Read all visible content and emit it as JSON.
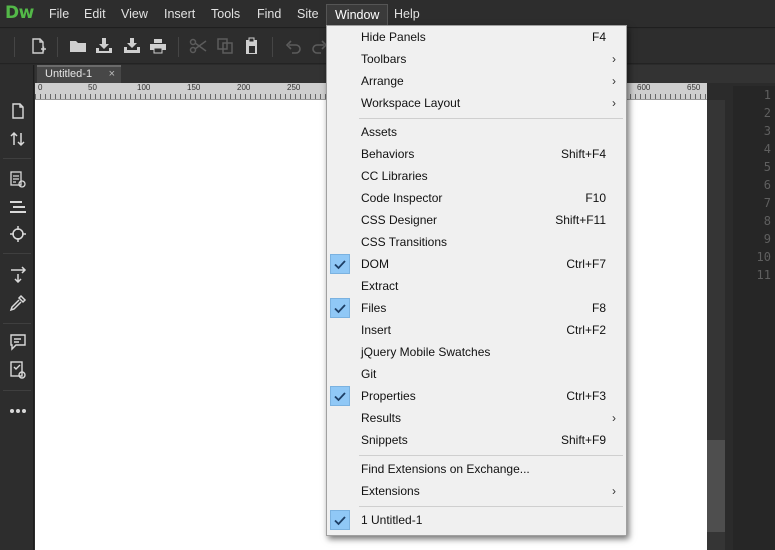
{
  "app": {
    "logo": "Dw"
  },
  "menubar": {
    "items": [
      {
        "label": "File"
      },
      {
        "label": "Edit"
      },
      {
        "label": "View"
      },
      {
        "label": "Insert"
      },
      {
        "label": "Tools"
      },
      {
        "label": "Find"
      },
      {
        "label": "Site"
      },
      {
        "label": "Window",
        "active": true
      },
      {
        "label": "Help"
      }
    ]
  },
  "toolbar": {
    "buttons": [
      {
        "icon": "new-file-icon"
      },
      {
        "icon": "open-folder-icon"
      },
      {
        "icon": "save-icon"
      },
      {
        "icon": "save-all-icon"
      },
      {
        "icon": "print-icon"
      },
      {
        "icon": "cut-icon",
        "enabled": false
      },
      {
        "icon": "copy-icon",
        "enabled": false
      },
      {
        "icon": "paste-icon"
      },
      {
        "icon": "undo-icon",
        "enabled": false
      },
      {
        "icon": "redo-icon",
        "enabled": false
      }
    ]
  },
  "left_panel": {
    "buttons": [
      {
        "icon": "file-icon"
      },
      {
        "icon": "sort-icon"
      },
      {
        "icon": "live-view-icon"
      },
      {
        "icon": "text-align-icon"
      },
      {
        "icon": "target-icon"
      },
      {
        "icon": "expand-icon"
      },
      {
        "icon": "eyedropper-icon"
      },
      {
        "icon": "comment-icon"
      },
      {
        "icon": "validate-icon"
      },
      {
        "icon": "more-icon"
      }
    ]
  },
  "document": {
    "tab_title": "Untitled-1",
    "tab_close": "×",
    "ruler_labels": [
      "0",
      "50",
      "100",
      "150",
      "200",
      "250",
      "600",
      "650"
    ],
    "line_numbers": [
      "1",
      "2",
      "3",
      "4",
      "5",
      "6",
      "7",
      "8",
      "9",
      "10",
      "11"
    ]
  },
  "window_menu": {
    "items": [
      {
        "label": "Hide Panels",
        "shortcut": "F4",
        "submenu": false,
        "checked": false
      },
      {
        "label": "Toolbars",
        "shortcut": "",
        "submenu": true,
        "checked": false
      },
      {
        "label": "Arrange",
        "shortcut": "",
        "submenu": true,
        "checked": false
      },
      {
        "label": "Workspace Layout",
        "shortcut": "",
        "submenu": true,
        "checked": false
      },
      {
        "separator": true
      },
      {
        "label": "Assets",
        "shortcut": "",
        "submenu": false,
        "checked": false
      },
      {
        "label": "Behaviors",
        "shortcut": "Shift+F4",
        "submenu": false,
        "checked": false
      },
      {
        "label": "CC Libraries",
        "shortcut": "",
        "submenu": false,
        "checked": false
      },
      {
        "label": "Code Inspector",
        "shortcut": "F10",
        "submenu": false,
        "checked": false
      },
      {
        "label": "CSS Designer",
        "shortcut": "Shift+F11",
        "submenu": false,
        "checked": false
      },
      {
        "label": "CSS Transitions",
        "shortcut": "",
        "submenu": false,
        "checked": false
      },
      {
        "label": "DOM",
        "shortcut": "Ctrl+F7",
        "submenu": false,
        "checked": true
      },
      {
        "label": "Extract",
        "shortcut": "",
        "submenu": false,
        "checked": false
      },
      {
        "label": "Files",
        "shortcut": "F8",
        "submenu": false,
        "checked": true
      },
      {
        "label": "Insert",
        "shortcut": "Ctrl+F2",
        "submenu": false,
        "checked": false
      },
      {
        "label": "jQuery Mobile Swatches",
        "shortcut": "",
        "submenu": false,
        "checked": false
      },
      {
        "label": "Git",
        "shortcut": "",
        "submenu": false,
        "checked": false
      },
      {
        "label": "Properties",
        "shortcut": "Ctrl+F3",
        "submenu": false,
        "checked": true
      },
      {
        "label": "Results",
        "shortcut": "",
        "submenu": true,
        "checked": false
      },
      {
        "label": "Snippets",
        "shortcut": "Shift+F9",
        "submenu": false,
        "checked": false
      },
      {
        "separator": true
      },
      {
        "label": "Find Extensions on Exchange...",
        "shortcut": "",
        "submenu": false,
        "checked": false
      },
      {
        "label": "Extensions",
        "shortcut": "",
        "submenu": true,
        "checked": false
      },
      {
        "separator": true
      },
      {
        "label": "1 Untitled-1",
        "shortcut": "",
        "submenu": false,
        "checked": true
      }
    ]
  },
  "colors": {
    "brand": "#53b848",
    "check_bg": "#90c8f6",
    "menu_bg": "#f0f0f0"
  }
}
